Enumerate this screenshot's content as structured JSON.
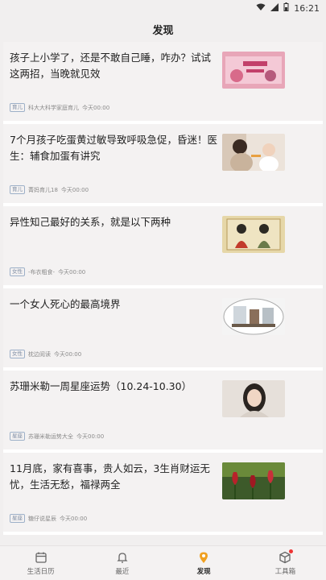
{
  "status_bar": {
    "time": "16:21"
  },
  "header": {
    "title": "发现"
  },
  "feed": [
    {
      "title": "孩子上小学了，还是不敢自己睡，咋办？试试这两招，当晚就见效",
      "tag": "育儿",
      "source": "科大大科学家庭育儿",
      "time": "今天00:00",
      "thumb": "pink-illustration"
    },
    {
      "title": "7个月孩子吃蛋黄过敏导致呼吸急促，昏迷！医生：辅食加蛋有讲究",
      "tag": "育儿",
      "source": "菁妈育儿18",
      "time": "今天00:00",
      "thumb": "mother-baby"
    },
    {
      "title": "异性知己最好的关系，就是以下两种",
      "tag": "女性",
      "source": "-布衣粗食-",
      "time": "今天00:00",
      "thumb": "vintage-woman"
    },
    {
      "title": "一个女人死心的最高境界",
      "tag": "女性",
      "source": "枕边阅读",
      "time": "今天00:00",
      "thumb": "room-window"
    },
    {
      "title": "苏珊米勒一周星座运势（10.24-10.30）",
      "tag": "星座",
      "source": "苏珊米勒运势大全",
      "time": "今天00:00",
      "thumb": "woman-portrait"
    },
    {
      "title": "11月底，家有喜事，贵人如云，3生肖财运无忧，生活无愁，福禄两全",
      "tag": "星座",
      "source": "糖仔说星辰",
      "time": "今天00:00",
      "thumb": "tulips"
    }
  ],
  "tabbar": {
    "tabs": [
      {
        "label": "生活日历"
      },
      {
        "label": "最近"
      },
      {
        "label": "发现"
      },
      {
        "label": "工具箱"
      }
    ]
  },
  "colors": {
    "accent": "#f0a020",
    "background": "#f1efef"
  }
}
